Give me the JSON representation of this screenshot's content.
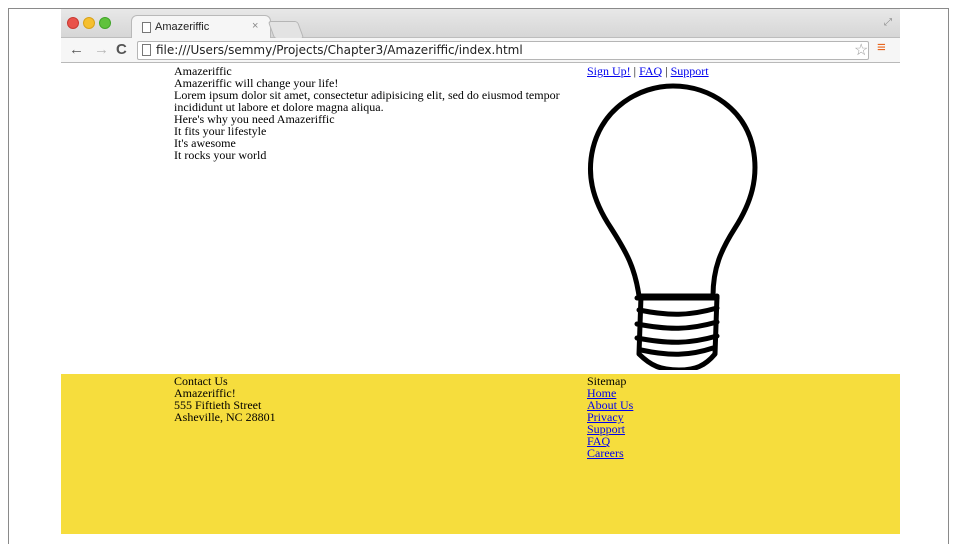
{
  "browser": {
    "tab_title": "Amazeriffic",
    "tab_close": "×",
    "url": "file:///Users/semmy/Projects/Chapter3/Amazeriffic/index.html"
  },
  "header": {
    "site_name": "Amazeriffic",
    "tagline": "Amazeriffic will change your life!",
    "lorem": "Lorem ipsum dolor sit amet, consectetur adipisicing elit, sed do eiusmod tempor incididunt ut labore et dolore magna aliqua.",
    "why_heading": "Here's why you need Amazeriffic",
    "reasons": [
      "It fits your lifestyle",
      "It's awesome",
      "It rocks your world"
    ]
  },
  "nav": {
    "signup": "Sign Up!",
    "sep1": " | ",
    "faq": "FAQ",
    "sep2": " | ",
    "support": "Support"
  },
  "footer": {
    "contact_heading": "Contact Us",
    "company": "Amazeriffic!",
    "street": "555 Fiftieth Street",
    "city": "Asheville, NC 28801",
    "sitemap_heading": "Sitemap",
    "sitemap_links": [
      "Home",
      "About Us",
      "Privacy",
      "Support",
      "FAQ",
      "Careers"
    ]
  },
  "colors": {
    "footer_bg": "#f6dd3d",
    "link": "#0000ee"
  },
  "icons": [
    "back-arrow-icon",
    "forward-arrow-icon",
    "reload-icon",
    "page-icon",
    "star-icon",
    "menu-icon",
    "lightbulb-icon"
  ]
}
